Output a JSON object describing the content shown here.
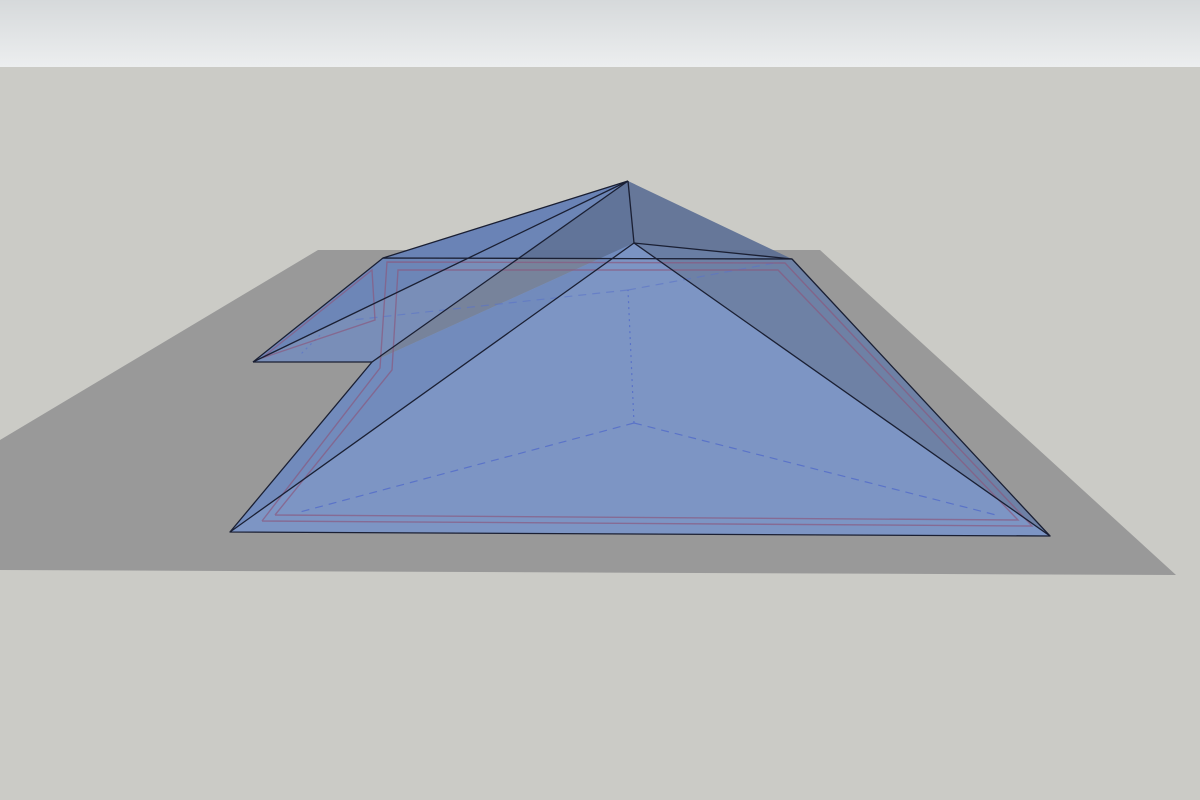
{
  "viewport": {
    "kind": "3d-model-viewport",
    "sky_top_color": "#d6d9db",
    "sky_bottom_color": "#eceeef",
    "ground_color": "#cbcbc6"
  },
  "model": {
    "shadow_color": "#999999",
    "roof_face_color": "#6e8ecf",
    "roof_face_opacity": 0.72,
    "roof_back_face_color": "#5a7098",
    "edge_color": "#1a1f33",
    "hidden_edge_color": "#5a73c8",
    "wall_outline_color": "#8a5a80"
  }
}
